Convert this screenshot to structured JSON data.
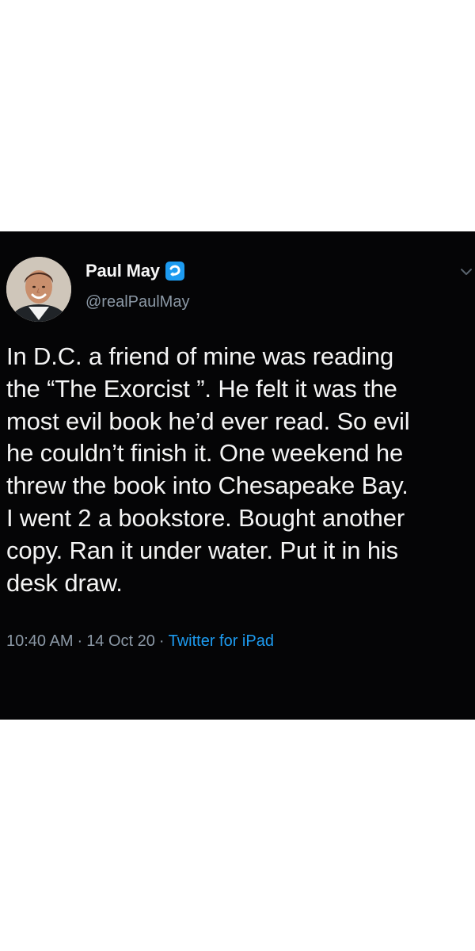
{
  "tweet": {
    "author": {
      "display_name": "Paul May",
      "handle": "@realPaulMay",
      "badge_icon": "verified-badge-icon",
      "avatar_icon": "profile-photo"
    },
    "text": "In D.C. a friend of mine was reading\nthe “The Exorcist ”. He felt it was the\nmost evil book he’d ever read. So evil\nhe couldn’t finish it. One weekend he\nthrew the book into Chesapeake Bay.\nI went 2 a bookstore. Bought another\ncopy. Ran it under water. Put it in his\ndesk draw.",
    "meta": {
      "time": "10:40 AM",
      "separator": "·",
      "date": "14 Oct 20",
      "source": "Twitter for iPad"
    },
    "menu_icon": "chevron-down-icon"
  },
  "colors": {
    "card_background": "#050506",
    "page_background": "#ffffff",
    "primary_text": "#f5f5f5",
    "secondary_text": "#8b98a5",
    "link_blue": "#1d9bf0"
  }
}
